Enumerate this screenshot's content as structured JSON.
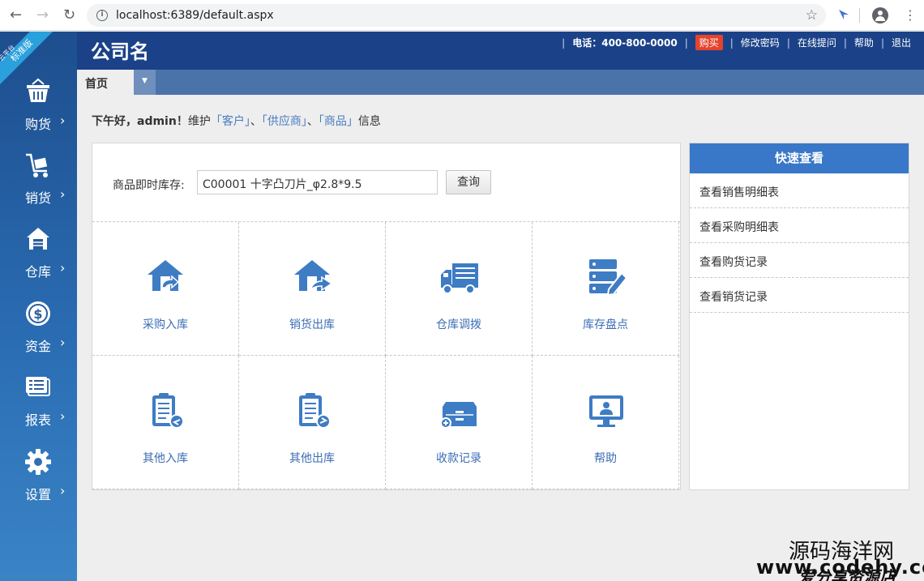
{
  "browser": {
    "url": "localhost:6389/default.aspx",
    "back_icon": "arrow-left-icon",
    "forward_icon": "arrow-right-icon",
    "reload_icon": "reload-icon"
  },
  "header": {
    "logo": "公司名",
    "phone": "电话：400-800-0000",
    "buy": "购买",
    "change_password": "修改密码",
    "online_help": "在线提问",
    "help": "帮助",
    "logout": "退出",
    "accent": "#1b4288"
  },
  "sidebar": {
    "edition_badge": "标准版",
    "edition_small": "云平台",
    "items": [
      {
        "label": "购货",
        "icon": "basket-icon"
      },
      {
        "label": "销货",
        "icon": "cart-icon"
      },
      {
        "label": "仓库",
        "icon": "warehouse-icon"
      },
      {
        "label": "资金",
        "icon": "dollar-icon"
      },
      {
        "label": "报表",
        "icon": "report-icon"
      },
      {
        "label": "设置",
        "icon": "gear-icon"
      }
    ],
    "chevron": "›"
  },
  "tabs": {
    "active": "首页"
  },
  "greeting": {
    "prefix": "下午好，admin！",
    "maintain": "维护",
    "link1": "「客户」",
    "sep1": "、",
    "link2": "「供应商」",
    "sep2": "、",
    "link3": "「商品」",
    "suffix": "信息"
  },
  "stock": {
    "label": "商品即时库存:",
    "value": "C00001 十字凸刀片_φ2.8*9.5",
    "button": "查询"
  },
  "shortcuts": [
    {
      "label": "采购入库",
      "icon": "purchase-in-icon"
    },
    {
      "label": "销货出库",
      "icon": "sales-out-icon"
    },
    {
      "label": "仓库调拨",
      "icon": "truck-icon"
    },
    {
      "label": "库存盘点",
      "icon": "inventory-check-icon"
    },
    {
      "label": "其他入库",
      "icon": "clipboard-in-icon"
    },
    {
      "label": "其他出库",
      "icon": "clipboard-out-icon"
    },
    {
      "label": "收款记录",
      "icon": "cash-box-icon"
    },
    {
      "label": "帮助",
      "icon": "monitor-icon"
    }
  ],
  "quick_view": {
    "title": "快速查看",
    "items": [
      "查看销售明细表",
      "查看采购明细表",
      "查看购货记录",
      "查看销货记录"
    ]
  },
  "watermark": {
    "line1": "源码海洋网",
    "line2": "www.codehy.com",
    "line3": "爱分享资源店"
  }
}
